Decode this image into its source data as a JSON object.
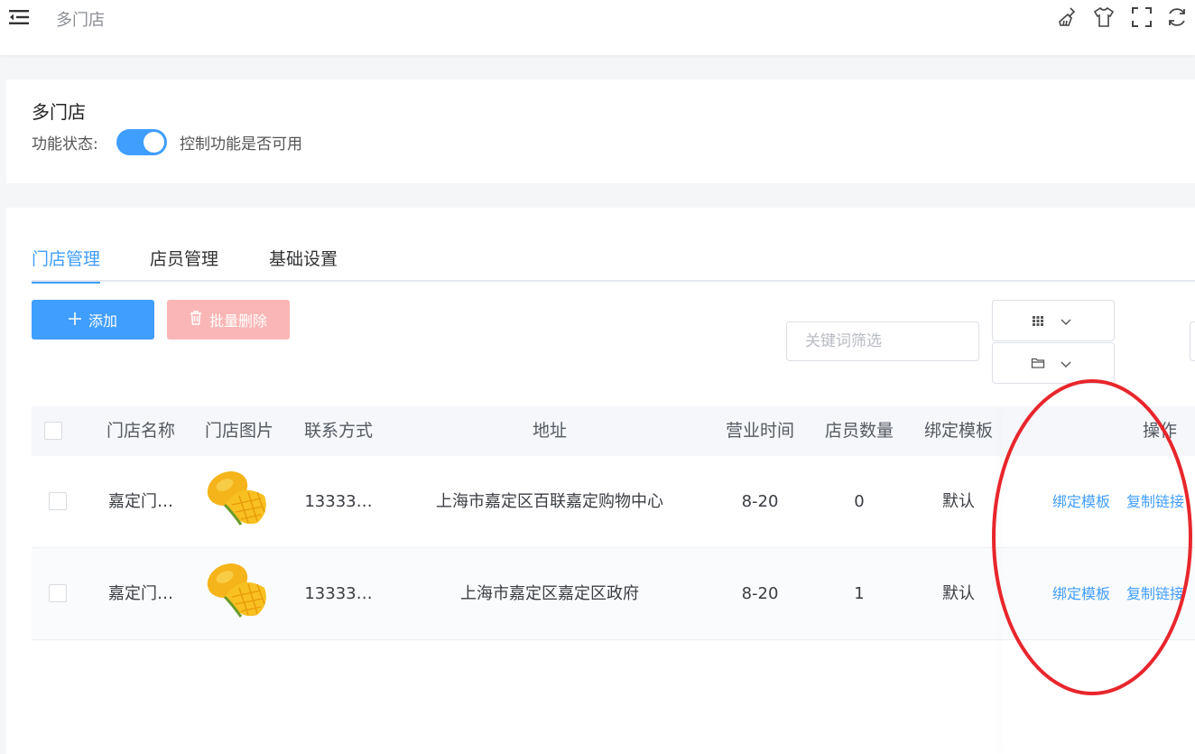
{
  "header": {
    "breadcrumb": "多门店",
    "icons": [
      "clear-cache-icon",
      "theme-shirt-icon",
      "fullscreen-icon",
      "refresh-icon"
    ]
  },
  "feature": {
    "title": "多门店",
    "status_label": "功能状态:",
    "enabled": true,
    "switch_desc": "控制功能是否可用"
  },
  "tabs": [
    {
      "label": "门店管理",
      "active": true
    },
    {
      "label": "店员管理",
      "active": false
    },
    {
      "label": "基础设置",
      "active": false
    }
  ],
  "toolbar": {
    "add_label": "添加",
    "batch_delete_label": "批量删除",
    "search_placeholder": "关键词筛选"
  },
  "table": {
    "columns": [
      "门店名称",
      "门店图片",
      "联系方式",
      "地址",
      "营业时间",
      "店员数量",
      "绑定模板",
      "操作"
    ],
    "rows": [
      {
        "name": "嘉定门…",
        "image": "mango-image",
        "contact": "13333…",
        "address": "上海市嘉定区百联嘉定购物中心",
        "hours": "8-20",
        "staff_count": "0",
        "template": "默认",
        "actions": [
          "绑定模板",
          "复制链接"
        ]
      },
      {
        "name": "嘉定门…",
        "image": "mango-image",
        "contact": "13333…",
        "address": "上海市嘉定区嘉定区政府",
        "hours": "8-20",
        "staff_count": "1",
        "template": "默认",
        "actions": [
          "绑定模板",
          "复制链接"
        ]
      }
    ]
  },
  "colors": {
    "primary": "#409eff",
    "danger_disabled": "#fab6b6",
    "annotation": "#e8262c"
  }
}
